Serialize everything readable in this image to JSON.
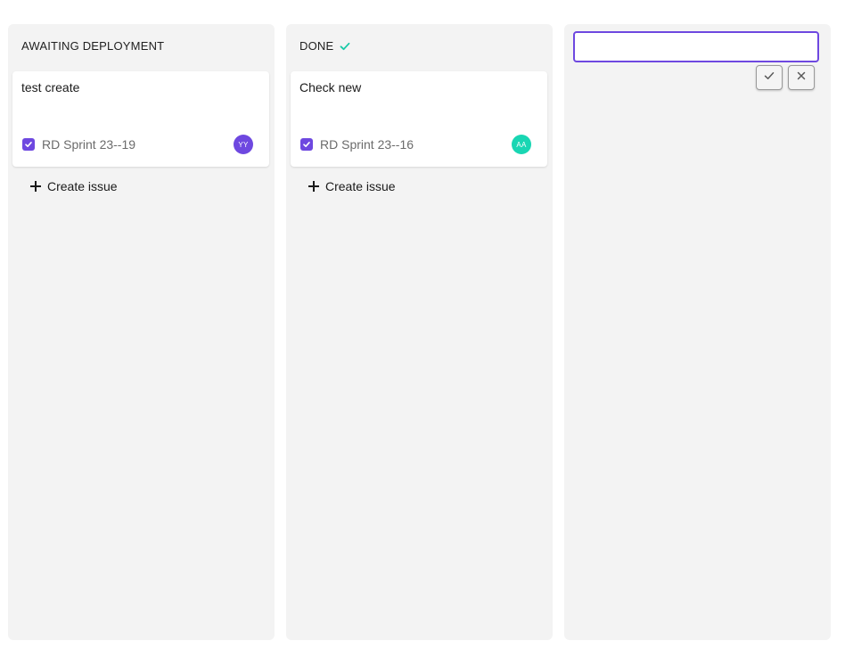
{
  "columns": [
    {
      "title": "AWAITING DEPLOYMENT",
      "card": {
        "title": "test create",
        "sprint": "RD Sprint 23--19",
        "avatar_initials": "YY",
        "avatar_color": "#6e48e0"
      },
      "create_label": "Create issue"
    },
    {
      "title": "DONE",
      "card": {
        "title": "Check new",
        "sprint": "RD Sprint 23--16",
        "avatar_initials": "AA",
        "avatar_color": "#19d6b3"
      },
      "create_label": "Create issue"
    }
  ],
  "new_column": {
    "input_value": "",
    "input_placeholder": ""
  },
  "colors": {
    "accent": "#6e48e0",
    "done_check": "#19c9a7",
    "column_bg": "#f3f3f3"
  },
  "icons": {
    "done": "check-icon",
    "create": "plus-icon",
    "confirm": "check-icon",
    "cancel": "close-icon",
    "card_type": "checkbox-icon"
  }
}
